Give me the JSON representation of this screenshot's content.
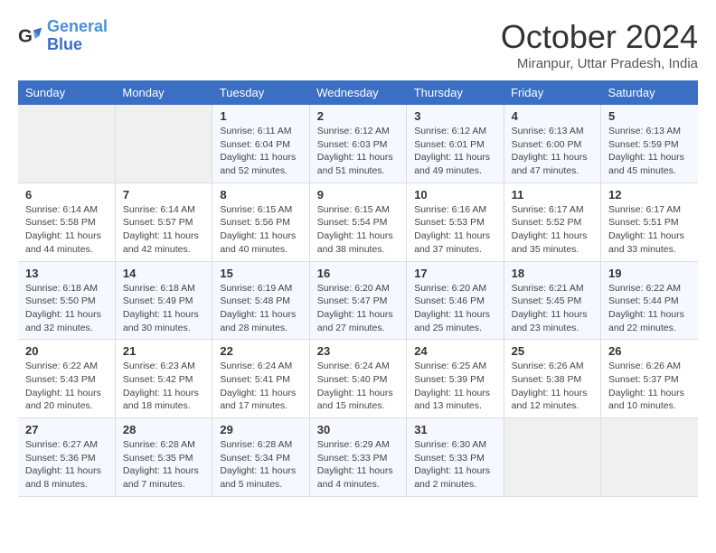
{
  "header": {
    "logo_line1": "General",
    "logo_line2": "Blue",
    "month": "October 2024",
    "location": "Miranpur, Uttar Pradesh, India"
  },
  "days_of_week": [
    "Sunday",
    "Monday",
    "Tuesday",
    "Wednesday",
    "Thursday",
    "Friday",
    "Saturday"
  ],
  "weeks": [
    [
      {
        "day": "",
        "info": ""
      },
      {
        "day": "",
        "info": ""
      },
      {
        "day": "1",
        "info": "Sunrise: 6:11 AM\nSunset: 6:04 PM\nDaylight: 11 hours and 52 minutes."
      },
      {
        "day": "2",
        "info": "Sunrise: 6:12 AM\nSunset: 6:03 PM\nDaylight: 11 hours and 51 minutes."
      },
      {
        "day": "3",
        "info": "Sunrise: 6:12 AM\nSunset: 6:01 PM\nDaylight: 11 hours and 49 minutes."
      },
      {
        "day": "4",
        "info": "Sunrise: 6:13 AM\nSunset: 6:00 PM\nDaylight: 11 hours and 47 minutes."
      },
      {
        "day": "5",
        "info": "Sunrise: 6:13 AM\nSunset: 5:59 PM\nDaylight: 11 hours and 45 minutes."
      }
    ],
    [
      {
        "day": "6",
        "info": "Sunrise: 6:14 AM\nSunset: 5:58 PM\nDaylight: 11 hours and 44 minutes."
      },
      {
        "day": "7",
        "info": "Sunrise: 6:14 AM\nSunset: 5:57 PM\nDaylight: 11 hours and 42 minutes."
      },
      {
        "day": "8",
        "info": "Sunrise: 6:15 AM\nSunset: 5:56 PM\nDaylight: 11 hours and 40 minutes."
      },
      {
        "day": "9",
        "info": "Sunrise: 6:15 AM\nSunset: 5:54 PM\nDaylight: 11 hours and 38 minutes."
      },
      {
        "day": "10",
        "info": "Sunrise: 6:16 AM\nSunset: 5:53 PM\nDaylight: 11 hours and 37 minutes."
      },
      {
        "day": "11",
        "info": "Sunrise: 6:17 AM\nSunset: 5:52 PM\nDaylight: 11 hours and 35 minutes."
      },
      {
        "day": "12",
        "info": "Sunrise: 6:17 AM\nSunset: 5:51 PM\nDaylight: 11 hours and 33 minutes."
      }
    ],
    [
      {
        "day": "13",
        "info": "Sunrise: 6:18 AM\nSunset: 5:50 PM\nDaylight: 11 hours and 32 minutes."
      },
      {
        "day": "14",
        "info": "Sunrise: 6:18 AM\nSunset: 5:49 PM\nDaylight: 11 hours and 30 minutes."
      },
      {
        "day": "15",
        "info": "Sunrise: 6:19 AM\nSunset: 5:48 PM\nDaylight: 11 hours and 28 minutes."
      },
      {
        "day": "16",
        "info": "Sunrise: 6:20 AM\nSunset: 5:47 PM\nDaylight: 11 hours and 27 minutes."
      },
      {
        "day": "17",
        "info": "Sunrise: 6:20 AM\nSunset: 5:46 PM\nDaylight: 11 hours and 25 minutes."
      },
      {
        "day": "18",
        "info": "Sunrise: 6:21 AM\nSunset: 5:45 PM\nDaylight: 11 hours and 23 minutes."
      },
      {
        "day": "19",
        "info": "Sunrise: 6:22 AM\nSunset: 5:44 PM\nDaylight: 11 hours and 22 minutes."
      }
    ],
    [
      {
        "day": "20",
        "info": "Sunrise: 6:22 AM\nSunset: 5:43 PM\nDaylight: 11 hours and 20 minutes."
      },
      {
        "day": "21",
        "info": "Sunrise: 6:23 AM\nSunset: 5:42 PM\nDaylight: 11 hours and 18 minutes."
      },
      {
        "day": "22",
        "info": "Sunrise: 6:24 AM\nSunset: 5:41 PM\nDaylight: 11 hours and 17 minutes."
      },
      {
        "day": "23",
        "info": "Sunrise: 6:24 AM\nSunset: 5:40 PM\nDaylight: 11 hours and 15 minutes."
      },
      {
        "day": "24",
        "info": "Sunrise: 6:25 AM\nSunset: 5:39 PM\nDaylight: 11 hours and 13 minutes."
      },
      {
        "day": "25",
        "info": "Sunrise: 6:26 AM\nSunset: 5:38 PM\nDaylight: 11 hours and 12 minutes."
      },
      {
        "day": "26",
        "info": "Sunrise: 6:26 AM\nSunset: 5:37 PM\nDaylight: 11 hours and 10 minutes."
      }
    ],
    [
      {
        "day": "27",
        "info": "Sunrise: 6:27 AM\nSunset: 5:36 PM\nDaylight: 11 hours and 8 minutes."
      },
      {
        "day": "28",
        "info": "Sunrise: 6:28 AM\nSunset: 5:35 PM\nDaylight: 11 hours and 7 minutes."
      },
      {
        "day": "29",
        "info": "Sunrise: 6:28 AM\nSunset: 5:34 PM\nDaylight: 11 hours and 5 minutes."
      },
      {
        "day": "30",
        "info": "Sunrise: 6:29 AM\nSunset: 5:33 PM\nDaylight: 11 hours and 4 minutes."
      },
      {
        "day": "31",
        "info": "Sunrise: 6:30 AM\nSunset: 5:33 PM\nDaylight: 11 hours and 2 minutes."
      },
      {
        "day": "",
        "info": ""
      },
      {
        "day": "",
        "info": ""
      }
    ]
  ]
}
